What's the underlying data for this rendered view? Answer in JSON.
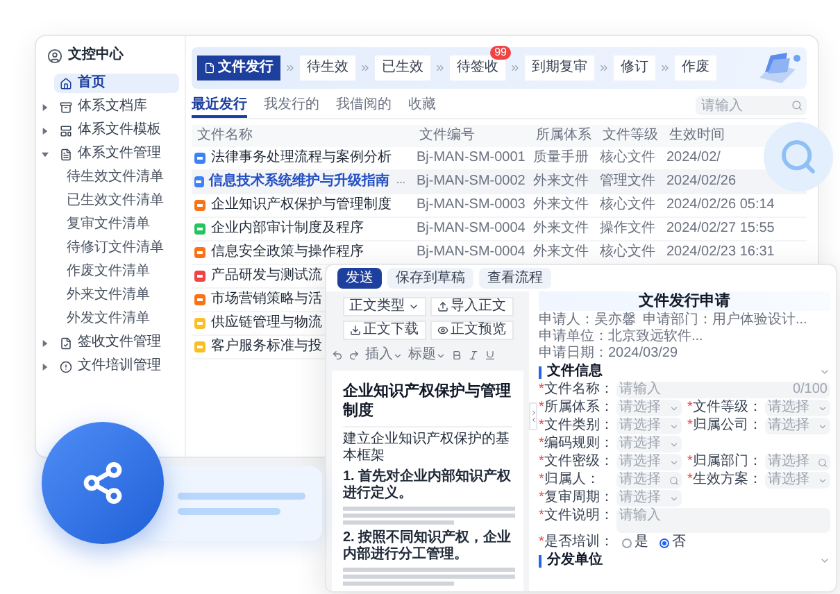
{
  "sidebar": {
    "title": "文控中心",
    "items": [
      {
        "label": "首页",
        "kind": "home",
        "selected": true
      },
      {
        "label": "体系文档库",
        "kind": "library",
        "selected": false,
        "expanded": false
      },
      {
        "label": "体系文件模板",
        "kind": "template",
        "selected": false,
        "expanded": false
      },
      {
        "label": "体系文件管理",
        "kind": "manage",
        "selected": false,
        "expanded": true,
        "children": [
          {
            "label": "待生效文件清单",
            "selected": false
          },
          {
            "label": "已生效文件清单",
            "selected": false
          },
          {
            "label": "复审文件清单",
            "selected": false
          },
          {
            "label": "待修订文件清单",
            "selected": false
          },
          {
            "label": "作废文件清单",
            "selected": false
          },
          {
            "label": "外来文件清单",
            "selected": false
          },
          {
            "label": "外发文件清单",
            "selected": false
          }
        ]
      },
      {
        "label": "签收文件管理",
        "kind": "sign",
        "selected": false,
        "expanded": false
      },
      {
        "label": "文件培训管理",
        "kind": "training",
        "selected": false,
        "expanded": false
      }
    ]
  },
  "steps": [
    {
      "label": "文件发行",
      "selected": true
    },
    {
      "label": "待生效",
      "selected": false
    },
    {
      "label": "已生效",
      "selected": false
    },
    {
      "label": "待签收",
      "selected": false,
      "badge": "99"
    },
    {
      "label": "到期复审",
      "selected": false
    },
    {
      "label": "修订",
      "selected": false
    },
    {
      "label": "作废",
      "selected": false
    }
  ],
  "tabs": [
    {
      "label": "最近发行",
      "selected": true
    },
    {
      "label": "我发行的",
      "selected": false
    },
    {
      "label": "我借阅的",
      "selected": false
    },
    {
      "label": "收藏",
      "selected": false
    }
  ],
  "search": {
    "placeholder": "请输入"
  },
  "table": {
    "columns": [
      "文件名称",
      "文件编号",
      "所属体系",
      "文件等级",
      "生效时间"
    ],
    "rows": [
      {
        "name": "法律事务处理流程与案例分析",
        "code": "Bj-MAN-SM-0001",
        "system": "质量手册",
        "level": "核心文件",
        "date": "2024/02/",
        "color": "#3b82f6",
        "selected": false
      },
      {
        "name": "信息技术系统维护与升级指南",
        "code": "Bj-MAN-SM-0002",
        "system": "外来文件",
        "level": "管理文件",
        "date": "2024/02/26",
        "color": "#3b82f6",
        "selected": true
      },
      {
        "name": "企业知识产权保护与管理制度",
        "code": "Bj-MAN-SM-0003",
        "system": "外来文件",
        "level": "核心文件",
        "date": "2024/02/26 05:14",
        "color": "#f97316",
        "selected": false
      },
      {
        "name": "企业内部审计制度及程序",
        "code": "Bj-MAN-SM-0004",
        "system": "外来文件",
        "level": "操作文件",
        "date": "2024/02/27 15:55",
        "color": "#22c55e",
        "selected": false
      },
      {
        "name": "信息安全政策与操作程序",
        "code": "Bj-MAN-SM-0004",
        "system": "外来文件",
        "level": "核心文件",
        "date": "2024/02/23 16:31",
        "color": "#f97316",
        "selected": false
      },
      {
        "name": "产品研发与测试流",
        "color": "#ef4444",
        "selected": false
      },
      {
        "name": "市场营销策略与活",
        "color": "#f97316",
        "selected": false
      },
      {
        "name": "供应链管理与物流",
        "color": "#fbbf24",
        "selected": false
      },
      {
        "name": "客户服务标准与投",
        "color": "#fbbf24",
        "selected": false
      }
    ]
  },
  "editor": {
    "actions": [
      {
        "label": "发送",
        "primary": true
      },
      {
        "label": "保存到草稿",
        "primary": false
      },
      {
        "label": "查看流程",
        "primary": false
      }
    ],
    "toolbar": [
      {
        "label": "正文类型",
        "kind": "dropdown"
      },
      {
        "label": "导入正文",
        "kind": "import"
      },
      {
        "label": "正文下载",
        "kind": "download"
      },
      {
        "label": "正文预览",
        "kind": "preview"
      }
    ],
    "format": [
      {
        "label": "插入"
      },
      {
        "label": "标题"
      }
    ],
    "doc_title": "企业知识产权保护与管理制度",
    "paragraphs": [
      {
        "text": "建立企业知识产权保护的基本框架",
        "bold": false
      },
      {
        "text": "1. 首先对企业内部知识产权进行定义。",
        "bold": true
      },
      {
        "text": "2. 按照不同知识产权，企业内部进行分工管理。",
        "bold": true
      }
    ]
  },
  "form": {
    "title": "文件发行申请",
    "required_mark": "*",
    "info": [
      "申请人：吴亦馨",
      "申请部门：用户体验设计...",
      "申请单位：北京致远软件...",
      "申请日期：2024/03/29"
    ],
    "section": "文件信息",
    "rows": [
      [
        {
          "label": "文件名称：",
          "placeholder": "请输入",
          "required": true,
          "kind": "input",
          "counter": "0/100"
        }
      ],
      [
        {
          "label": "所属体系：",
          "placeholder": "请选择",
          "required": true,
          "kind": "select"
        },
        {
          "label": "文件等级：",
          "placeholder": "请选择",
          "required": true,
          "kind": "select"
        }
      ],
      [
        {
          "label": "文件类别：",
          "placeholder": "请选择",
          "required": true,
          "kind": "select"
        },
        {
          "label": "归属公司：",
          "placeholder": "请选择",
          "required": true,
          "kind": "select"
        }
      ],
      [
        {
          "label": "编码规则：",
          "placeholder": "请选择",
          "required": true,
          "kind": "select"
        }
      ],
      [
        {
          "label": "文件密级：",
          "placeholder": "请选择",
          "required": true,
          "kind": "select"
        },
        {
          "label": "归属部门：",
          "placeholder": "请选择",
          "required": true,
          "kind": "search"
        }
      ],
      [
        {
          "label": "归属人：",
          "placeholder": "请选择",
          "required": true,
          "kind": "search"
        },
        {
          "label": "生效方案：",
          "placeholder": "请选择",
          "required": true,
          "kind": "select"
        }
      ],
      [
        {
          "label": "复审周期：",
          "placeholder": "请选择",
          "required": true,
          "kind": "select"
        }
      ],
      [
        {
          "label": "文件说明：",
          "placeholder": "请输入",
          "required": true,
          "kind": "textarea"
        }
      ]
    ],
    "training": {
      "label": "是否培训：",
      "required": true,
      "options": [
        {
          "label": "是",
          "selected": false
        },
        {
          "label": "否",
          "selected": true
        }
      ]
    },
    "section2": "分发单位"
  }
}
